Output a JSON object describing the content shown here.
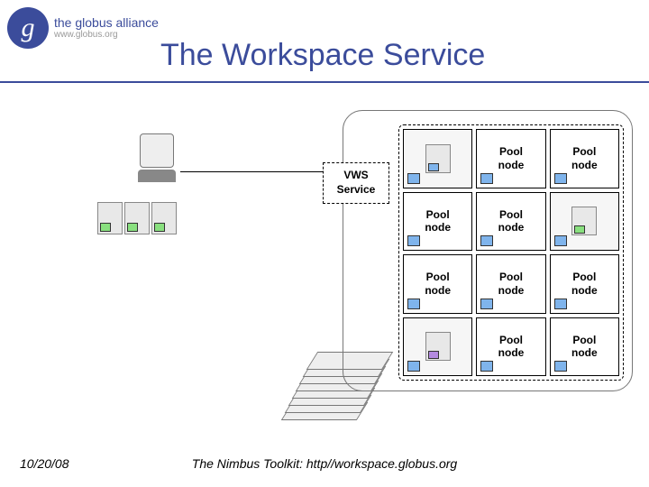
{
  "logo": {
    "glyph": "g",
    "main": "the globus alliance",
    "sub": "www.globus.org"
  },
  "title": "The Workspace Service",
  "vws_label_l1": "VWS",
  "vws_label_l2": "Service",
  "pool_label_l1": "Pool",
  "pool_label_l2": "node",
  "grid": [
    {
      "type": "icon",
      "variant": "blue"
    },
    {
      "type": "label"
    },
    {
      "type": "label"
    },
    {
      "type": "label"
    },
    {
      "type": "label"
    },
    {
      "type": "icon",
      "variant": "green"
    },
    {
      "type": "label"
    },
    {
      "type": "label"
    },
    {
      "type": "label"
    },
    {
      "type": "icon",
      "variant": "purple"
    },
    {
      "type": "label"
    },
    {
      "type": "label"
    }
  ],
  "footer": {
    "date": "10/20/08",
    "caption": "The Nimbus Toolkit: http//workspace.globus.org"
  }
}
